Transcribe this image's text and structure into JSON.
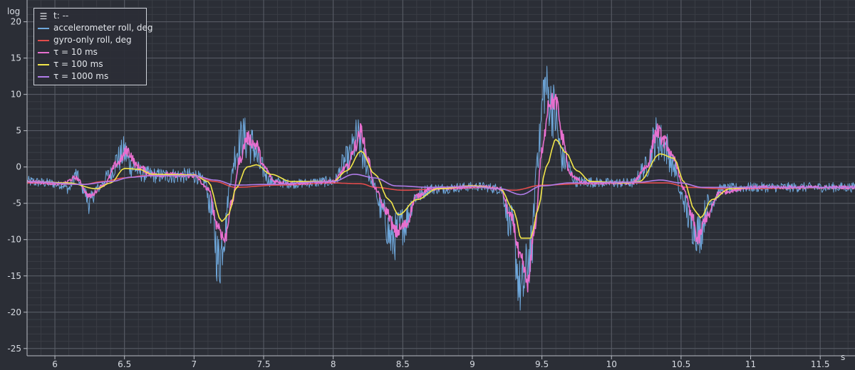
{
  "chart_data": {
    "type": "line",
    "ylabel": "log",
    "xlabel": "s",
    "xlim": [
      5.8,
      11.75
    ],
    "ylim": [
      -26,
      23
    ],
    "x_ticks": [
      6,
      6.5,
      7,
      7.5,
      8,
      8.5,
      9,
      9.5,
      10,
      10.5,
      11,
      11.5
    ],
    "y_ticks": [
      20,
      15,
      10,
      5,
      0,
      -5,
      -10,
      -15,
      -20,
      -25
    ],
    "grid": true,
    "legend_placement": "top-left",
    "legend_header": "t: --",
    "colors": {
      "background": "#2b2e36",
      "grid_major": "#5a5e68",
      "grid_minor": "#3a3d45",
      "axis": "#b8bcc4"
    },
    "series": [
      {
        "name": "accelerometer roll, deg",
        "color": "#6fa8dc",
        "noise": 1.6,
        "points": [
          [
            5.8,
            -2
          ],
          [
            5.95,
            -2.2
          ],
          [
            6.05,
            -2.5
          ],
          [
            6.1,
            -3
          ],
          [
            6.15,
            -1
          ],
          [
            6.2,
            -3
          ],
          [
            6.25,
            -5
          ],
          [
            6.3,
            -3
          ],
          [
            6.4,
            -1
          ],
          [
            6.45,
            1
          ],
          [
            6.5,
            2
          ],
          [
            6.55,
            0
          ],
          [
            6.65,
            -1
          ],
          [
            6.75,
            -1.2
          ],
          [
            7.0,
            -1.2
          ],
          [
            7.08,
            -2
          ],
          [
            7.12,
            -6
          ],
          [
            7.18,
            -13
          ],
          [
            7.22,
            -9
          ],
          [
            7.26,
            -2
          ],
          [
            7.3,
            2
          ],
          [
            7.35,
            4
          ],
          [
            7.42,
            3
          ],
          [
            7.48,
            0
          ],
          [
            7.55,
            -2
          ],
          [
            7.7,
            -2.3
          ],
          [
            8.0,
            -2
          ],
          [
            8.1,
            1
          ],
          [
            8.18,
            4
          ],
          [
            8.22,
            1
          ],
          [
            8.28,
            -2
          ],
          [
            8.35,
            -6
          ],
          [
            8.42,
            -10
          ],
          [
            8.5,
            -8
          ],
          [
            8.6,
            -4
          ],
          [
            8.7,
            -3
          ],
          [
            9.05,
            -2.7
          ],
          [
            9.2,
            -3
          ],
          [
            9.28,
            -8
          ],
          [
            9.35,
            -17
          ],
          [
            9.42,
            -12
          ],
          [
            9.47,
            2
          ],
          [
            9.52,
            11
          ],
          [
            9.58,
            8
          ],
          [
            9.65,
            1
          ],
          [
            9.75,
            -2
          ],
          [
            10.0,
            -2.2
          ],
          [
            10.15,
            -2.2
          ],
          [
            10.25,
            0
          ],
          [
            10.32,
            4
          ],
          [
            10.38,
            3
          ],
          [
            10.45,
            0
          ],
          [
            10.5,
            -4
          ],
          [
            10.58,
            -8
          ],
          [
            10.63,
            -9
          ],
          [
            10.7,
            -5
          ],
          [
            10.8,
            -3
          ],
          [
            11.0,
            -2.8
          ],
          [
            11.75,
            -2.8
          ]
        ]
      },
      {
        "name": "gyro-only roll, deg",
        "color": "#e24c4c",
        "noise": 0,
        "points": [
          [
            5.8,
            -2.2
          ],
          [
            6.2,
            -2.4
          ],
          [
            6.35,
            -2
          ],
          [
            6.5,
            -1.5
          ],
          [
            6.65,
            -1.2
          ],
          [
            7.0,
            -1.2
          ],
          [
            7.15,
            -2
          ],
          [
            7.3,
            -2.8
          ],
          [
            7.6,
            -2.5
          ],
          [
            8.0,
            -2.2
          ],
          [
            8.2,
            -2.3
          ],
          [
            8.3,
            -2.8
          ],
          [
            8.5,
            -3.2
          ],
          [
            8.8,
            -3
          ],
          [
            9.1,
            -2.8
          ],
          [
            9.3,
            -3.2
          ],
          [
            9.5,
            -2.5
          ],
          [
            9.8,
            -2.3
          ],
          [
            10.2,
            -2.2
          ],
          [
            10.4,
            -2.2
          ],
          [
            10.55,
            -2.8
          ],
          [
            10.8,
            -3
          ],
          [
            11.75,
            -2.8
          ]
        ]
      },
      {
        "name": "τ = 10 ms",
        "color": "#e86fcf",
        "noise": 0.5,
        "points": [
          [
            5.8,
            -2
          ],
          [
            6.05,
            -2.3
          ],
          [
            6.15,
            -1.5
          ],
          [
            6.25,
            -4
          ],
          [
            6.35,
            -2.5
          ],
          [
            6.45,
            0.5
          ],
          [
            6.52,
            2.2
          ],
          [
            6.6,
            0
          ],
          [
            6.7,
            -1
          ],
          [
            7.0,
            -1.2
          ],
          [
            7.1,
            -3
          ],
          [
            7.17,
            -8
          ],
          [
            7.22,
            -10
          ],
          [
            7.27,
            -5
          ],
          [
            7.33,
            1
          ],
          [
            7.38,
            4
          ],
          [
            7.45,
            3
          ],
          [
            7.5,
            0
          ],
          [
            7.58,
            -2
          ],
          [
            7.7,
            -2.3
          ],
          [
            8.0,
            -2
          ],
          [
            8.1,
            0
          ],
          [
            8.16,
            3
          ],
          [
            8.2,
            5
          ],
          [
            8.25,
            1
          ],
          [
            8.3,
            -3
          ],
          [
            8.38,
            -6
          ],
          [
            8.45,
            -9
          ],
          [
            8.52,
            -8
          ],
          [
            8.6,
            -4
          ],
          [
            8.7,
            -3
          ],
          [
            9.05,
            -2.7
          ],
          [
            9.2,
            -3
          ],
          [
            9.28,
            -7
          ],
          [
            9.35,
            -13
          ],
          [
            9.4,
            -16
          ],
          [
            9.45,
            -8
          ],
          [
            9.5,
            2
          ],
          [
            9.55,
            9
          ],
          [
            9.6,
            9
          ],
          [
            9.65,
            4
          ],
          [
            9.7,
            -1
          ],
          [
            9.8,
            -2.2
          ],
          [
            10.15,
            -2.2
          ],
          [
            10.25,
            0
          ],
          [
            10.33,
            5
          ],
          [
            10.38,
            3.5
          ],
          [
            10.45,
            1
          ],
          [
            10.52,
            -3
          ],
          [
            10.58,
            -7
          ],
          [
            10.62,
            -10
          ],
          [
            10.68,
            -7
          ],
          [
            10.78,
            -3.5
          ],
          [
            11.0,
            -2.8
          ],
          [
            11.75,
            -2.8
          ]
        ]
      },
      {
        "name": "τ = 100 ms",
        "color": "#f2e64a",
        "noise": 0,
        "points": [
          [
            5.8,
            -2
          ],
          [
            6.1,
            -2.2
          ],
          [
            6.3,
            -3
          ],
          [
            6.4,
            -2.2
          ],
          [
            6.5,
            -0.2
          ],
          [
            6.6,
            -0.3
          ],
          [
            6.7,
            -1
          ],
          [
            7.0,
            -1.1
          ],
          [
            7.1,
            -2
          ],
          [
            7.2,
            -7.5
          ],
          [
            7.25,
            -6.5
          ],
          [
            7.3,
            -3
          ],
          [
            7.38,
            0
          ],
          [
            7.45,
            0.3
          ],
          [
            7.55,
            -1
          ],
          [
            7.7,
            -2
          ],
          [
            8.0,
            -2
          ],
          [
            8.1,
            -0.5
          ],
          [
            8.2,
            2.2
          ],
          [
            8.3,
            -1
          ],
          [
            8.4,
            -4.5
          ],
          [
            8.47,
            -6.6
          ],
          [
            8.6,
            -4.5
          ],
          [
            8.75,
            -3
          ],
          [
            9.0,
            -2.6
          ],
          [
            9.2,
            -3
          ],
          [
            9.3,
            -6
          ],
          [
            9.35,
            -9.8
          ],
          [
            9.42,
            -9.8
          ],
          [
            9.47,
            -6
          ],
          [
            9.53,
            0
          ],
          [
            9.6,
            3.8
          ],
          [
            9.67,
            2
          ],
          [
            9.75,
            -0.5
          ],
          [
            9.85,
            -2
          ],
          [
            10.1,
            -2.2
          ],
          [
            10.2,
            -2
          ],
          [
            10.35,
            1.8
          ],
          [
            10.45,
            1.2
          ],
          [
            10.52,
            -2
          ],
          [
            10.6,
            -6
          ],
          [
            10.64,
            -7
          ],
          [
            10.72,
            -4.5
          ],
          [
            10.85,
            -3
          ],
          [
            11.0,
            -2.8
          ],
          [
            11.75,
            -2.8
          ]
        ]
      },
      {
        "name": "τ = 1000 ms",
        "color": "#b07ce8",
        "noise": 0,
        "points": [
          [
            5.8,
            -2
          ],
          [
            6.2,
            -2.4
          ],
          [
            6.4,
            -2
          ],
          [
            6.55,
            -1.4
          ],
          [
            6.7,
            -1.2
          ],
          [
            7.0,
            -1.2
          ],
          [
            7.15,
            -1.8
          ],
          [
            7.3,
            -2.5
          ],
          [
            7.5,
            -2.4
          ],
          [
            8.0,
            -2
          ],
          [
            8.15,
            -1
          ],
          [
            8.3,
            -1.5
          ],
          [
            8.45,
            -2.6
          ],
          [
            8.7,
            -2.8
          ],
          [
            9.0,
            -2.7
          ],
          [
            9.2,
            -3
          ],
          [
            9.35,
            -3.8
          ],
          [
            9.5,
            -2.6
          ],
          [
            9.7,
            -2.2
          ],
          [
            10.2,
            -2.1
          ],
          [
            10.35,
            -1.8
          ],
          [
            10.5,
            -2.2
          ],
          [
            10.65,
            -2.8
          ],
          [
            10.8,
            -2.8
          ],
          [
            11.75,
            -2.8
          ]
        ]
      }
    ]
  }
}
